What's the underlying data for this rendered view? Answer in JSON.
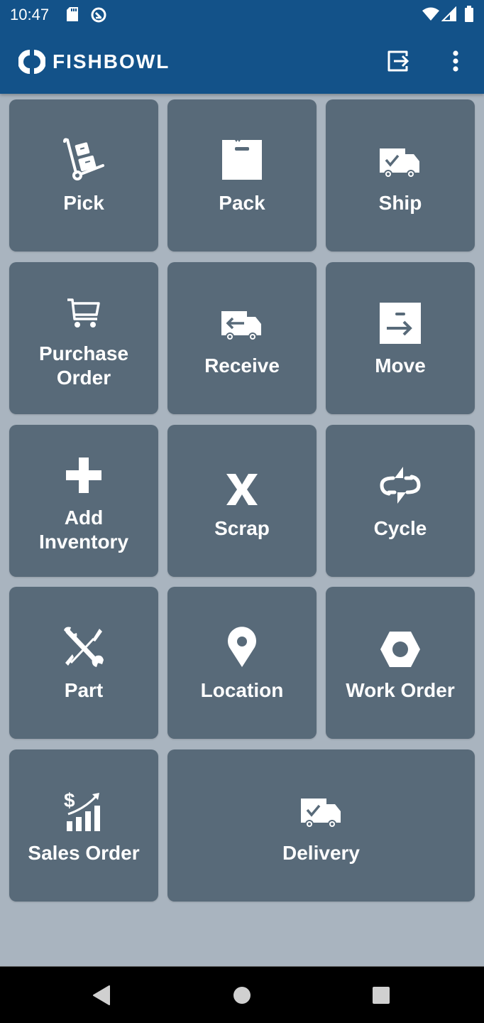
{
  "status_bar": {
    "time": "10:47",
    "left_icons": [
      "sd-card-icon",
      "vpn-key-icon"
    ],
    "right_icons": [
      "wifi-icon",
      "cell-signal-icon",
      "battery-icon"
    ]
  },
  "app_bar": {
    "brand": "FISHBOWL",
    "actions": [
      {
        "name": "logout-button",
        "icon": "logout-icon"
      },
      {
        "name": "overflow-menu-button",
        "icon": "more-vert-icon"
      }
    ]
  },
  "colors": {
    "app_bar": "#135289",
    "background": "#a9b4bf",
    "tile": "#586a79",
    "tile_text": "#ffffff"
  },
  "tiles": [
    {
      "label": "Pick",
      "icon": "hand-truck-icon"
    },
    {
      "label": "Pack",
      "icon": "package-icon"
    },
    {
      "label": "Ship",
      "icon": "truck-check-icon"
    },
    {
      "label": "Purchase\nOrder",
      "icon": "cart-icon"
    },
    {
      "label": "Receive",
      "icon": "truck-arrow-left-icon"
    },
    {
      "label": "Move",
      "icon": "move-arrow-icon"
    },
    {
      "label": "Add\nInventory",
      "icon": "plus-icon"
    },
    {
      "label": "Scrap",
      "icon": "x-icon"
    },
    {
      "label": "Cycle",
      "icon": "cycle-icon"
    },
    {
      "label": "Part",
      "icon": "tools-icon"
    },
    {
      "label": "Location",
      "icon": "map-pin-icon"
    },
    {
      "label": "Work Order",
      "icon": "hex-nut-icon"
    },
    {
      "label": "Sales Order",
      "icon": "sales-chart-icon"
    },
    {
      "label": "Delivery",
      "icon": "truck-check-icon"
    }
  ],
  "nav_bar": {
    "buttons": [
      "back-icon",
      "home-icon",
      "recents-icon"
    ]
  }
}
